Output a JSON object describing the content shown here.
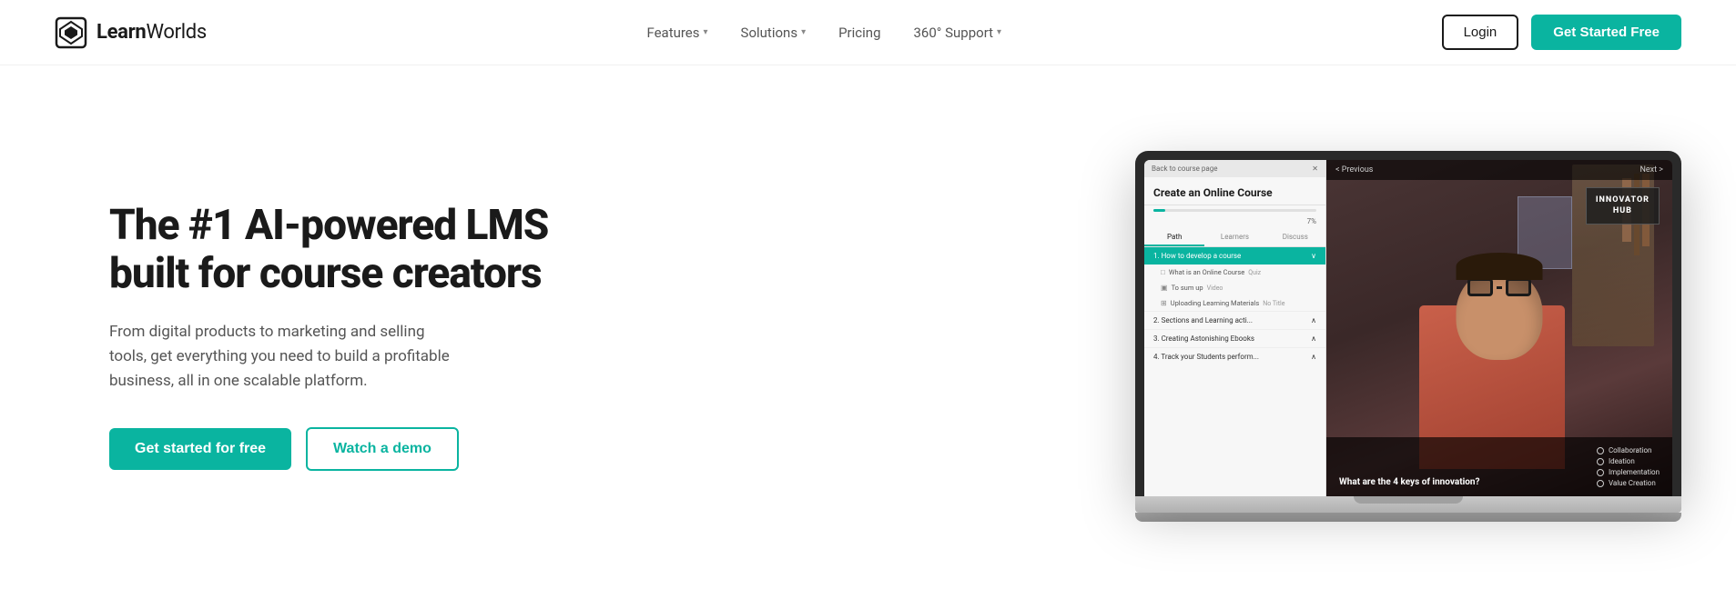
{
  "brand": {
    "name_bold": "Learn",
    "name_light": "Worlds",
    "logo_unicode": "◈"
  },
  "nav": {
    "items": [
      {
        "label": "Features",
        "has_dropdown": true
      },
      {
        "label": "Solutions",
        "has_dropdown": true
      },
      {
        "label": "Pricing",
        "has_dropdown": false
      },
      {
        "label": "360° Support",
        "has_dropdown": true
      }
    ]
  },
  "header_actions": {
    "login_label": "Login",
    "cta_label": "Get Started Free"
  },
  "hero": {
    "title_line1": "The #1 AI-powered LMS",
    "title_line2": "built for course creators",
    "description": "From digital products to marketing and selling tools, get everything you need to build a profitable business, all in one scalable platform.",
    "btn_primary": "Get started for free",
    "btn_secondary": "Watch a demo"
  },
  "laptop_screen": {
    "sidebar_back_text": "Back to course page",
    "course_title": "Create an Online Course",
    "progress_pct": "7%",
    "tabs": [
      "Path",
      "Learners",
      "Discuss"
    ],
    "active_tab": "Path",
    "sections": [
      {
        "label": "1. How to develop a course",
        "active": true
      },
      {
        "sub_items": [
          {
            "icon": "□",
            "label": "What is an Online Course",
            "sublabel": "Quiz"
          },
          {
            "icon": "⬛",
            "label": "To sum up",
            "sublabel": "Video"
          },
          {
            "icon": "⬛",
            "label": "Uploading Learning Materials",
            "sublabel": "No Title"
          }
        ]
      },
      {
        "label": "2. Sections and Learning acti...",
        "active": false
      },
      {
        "label": "3. Creating Astonishing Ebooks",
        "active": false
      },
      {
        "label": "4. Track your Students perform...",
        "active": false
      }
    ],
    "video_nav": {
      "prev": "< Previous",
      "next": "Next >"
    },
    "innovator_hub": "INNOVATOR\nHUB",
    "video_question": "What are the 4 keys of innovation?",
    "quiz_options": [
      "Collaboration",
      "Ideation",
      "Implementation",
      "Value Creation"
    ]
  },
  "colors": {
    "accent": "#0ab4a0",
    "dark": "#1a1a1a",
    "text_muted": "#555555"
  }
}
